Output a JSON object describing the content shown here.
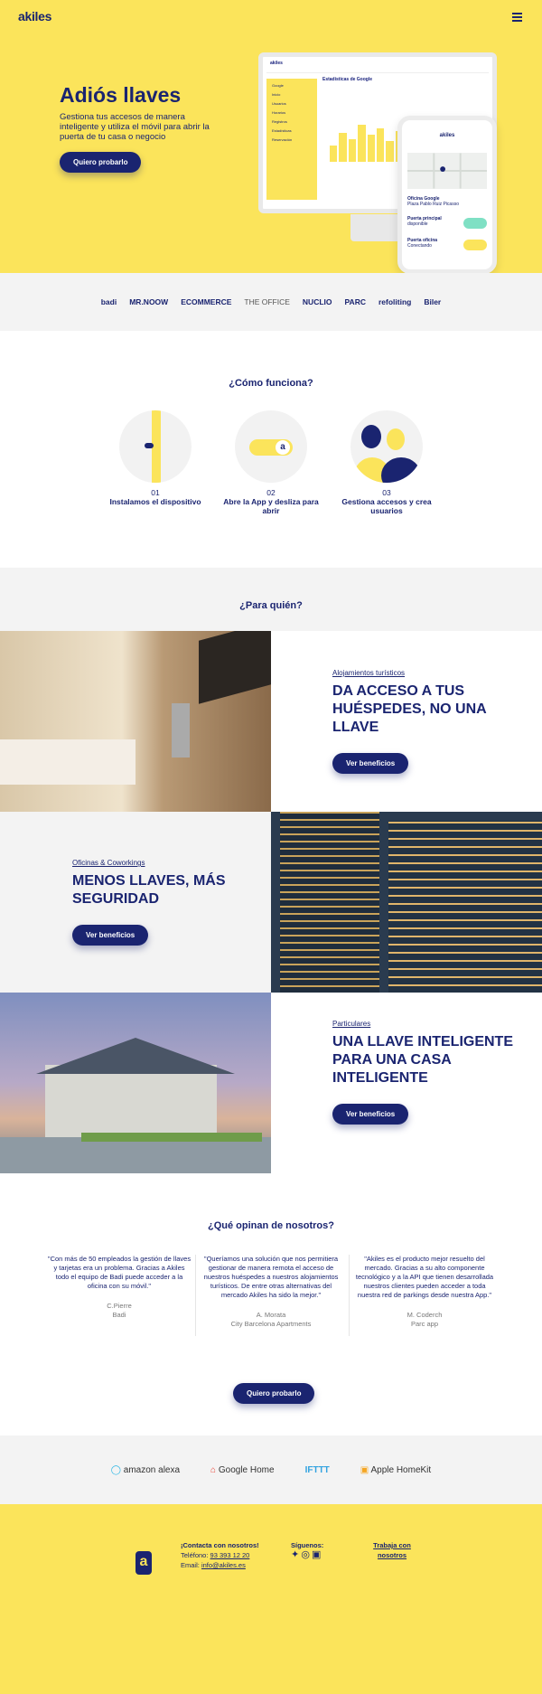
{
  "header": {
    "logo": "akiles",
    "menu_icon": "hamburger-icon"
  },
  "hero": {
    "title": "Adiós llaves",
    "subtitle": "Gestiona tus accesos de manera inteligente y utiliza el móvil para abrir la puerta de tu casa o negocio",
    "cta": "Quiero probarlo",
    "monitor": {
      "app": "akiles",
      "header_title": "Estadísticas de Google",
      "sidebar": [
        "Google",
        "Inicio",
        "Usuarios",
        "Horarios",
        "Registros",
        "Estadísticas",
        "Reservación"
      ]
    },
    "phone": {
      "brand": "akiles",
      "rows": [
        {
          "title": "Oficina Google",
          "sub": "Plaza Pablo Ruiz Picasso"
        },
        {
          "title": "Puerta principal",
          "sub": "disponible"
        },
        {
          "title": "Puerta oficina",
          "sub": "Conectando"
        }
      ]
    }
  },
  "brands": [
    "badi",
    "MR.NOOW",
    "ECOMMERCE",
    "THE OFFICE",
    "NUCLIO",
    "PARC",
    "refoliting",
    "Biler"
  ],
  "how": {
    "title": "¿Cómo funciona?",
    "steps": [
      {
        "num": "01",
        "label": "Instalamos el dispositivo"
      },
      {
        "num": "02",
        "label": "Abre la App y desliza para abrir"
      },
      {
        "num": "03",
        "label": "Gestiona accesos y crea usuarios"
      }
    ]
  },
  "who": {
    "title": "¿Para quién?",
    "items": [
      {
        "category": "Alojamientos turísticos",
        "headline": "DA ACCESO A TUS HUÉSPEDES, NO UNA LLAVE",
        "cta": "Ver beneficios"
      },
      {
        "category": "Oficinas & Coworkings",
        "headline": "MENOS LLAVES, MÁS SEGURIDAD",
        "cta": "Ver beneficios"
      },
      {
        "category": "Particulares",
        "headline": "UNA LLAVE INTELIGENTE PARA UNA CASA INTELIGENTE",
        "cta": "Ver beneficios"
      }
    ]
  },
  "testimonials": {
    "title": "¿Qué opinan de nosotros?",
    "items": [
      {
        "quote": "\"Con más de 50 empleados la gestión de llaves y tarjetas era un problema. Gracias a Akiles todo el equipo de Badi puede acceder a la oficina con su móvil.\"",
        "author": "C.Pierre",
        "company": "Badi"
      },
      {
        "quote": "\"Queríamos una solución que nos permitiera gestionar de manera remota el acceso de nuestros huéspedes a nuestros alojamientos turísticos. De entre otras alternativas del mercado Akiles ha sido la mejor.\"",
        "author": "A. Morata",
        "company": "City Barcelona Apartments"
      },
      {
        "quote": "\"Akiles es el producto mejor resuelto del mercado. Gracias a su alto componente tecnológico y a la API que tienen desarrollada nuestros clientes pueden acceder a toda nuestra red de parkings desde nuestra App.\"",
        "author": "M. Coderch",
        "company": "Parc app"
      }
    ],
    "cta": "Quiero probarlo"
  },
  "integrations": [
    "amazon alexa",
    "Google Home",
    "IFTTT",
    "Apple HomeKit"
  ],
  "footer": {
    "contact_title": "¡Contacta con nosotros!",
    "phone_label": "Teléfono:",
    "phone": "93 393 12 20",
    "email_label": "Email:",
    "email": "info@akiles.es",
    "follow": "Síguenos:",
    "jobs": "Trabaja con nosotros"
  },
  "colors": {
    "yellow": "#fbe45b",
    "navy": "#1a2470",
    "grey": "#f3f3f3"
  }
}
